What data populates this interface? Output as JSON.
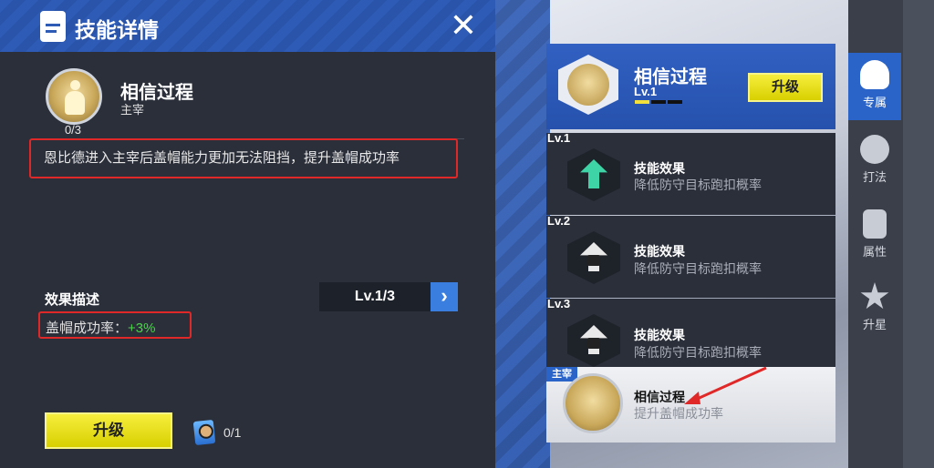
{
  "dialog": {
    "title": "技能详情",
    "skill_name": "相信过程",
    "skill_role": "主宰",
    "progress": "0/3",
    "description": "恩比德进入主宰后盖帽能力更加无法阻挡，提升盖帽成功率",
    "effect_title": "效果描述",
    "level": "Lv.1/3",
    "effect_label": "盖帽成功率：",
    "effect_value": "+3%",
    "upgrade_label": "升级",
    "card_count": "0/1"
  },
  "skill_card": {
    "name": "相信过程",
    "level": "Lv.1",
    "upgrade_label": "升级",
    "level_progress": 1,
    "level_max": 3
  },
  "levels": [
    {
      "tag": "Lv.1",
      "title": "技能效果",
      "desc": "降低防守目标跑扣概率",
      "locked": false
    },
    {
      "tag": "Lv.2",
      "title": "技能效果",
      "desc": "降低防守目标跑扣概率",
      "locked": true
    },
    {
      "tag": "Lv.3",
      "title": "技能效果",
      "desc": "降低防守目标跑扣概率",
      "locked": true
    }
  ],
  "main_skill": {
    "tag": "主宰",
    "name": "相信过程",
    "desc": "提升盖帽成功率"
  },
  "side_nav": [
    {
      "label": "专属",
      "icon": "jersey-icon",
      "active": true
    },
    {
      "label": "打法",
      "icon": "basketball-icon",
      "active": false
    },
    {
      "label": "属性",
      "icon": "document-icon",
      "active": false
    },
    {
      "label": "升星",
      "icon": "star-icon",
      "active": false
    }
  ],
  "colors": {
    "accent_blue": "#2a64c8",
    "upgrade_yellow": "#f6ee3d",
    "effect_green": "#4cd34c",
    "highlight_red": "#e02828"
  }
}
